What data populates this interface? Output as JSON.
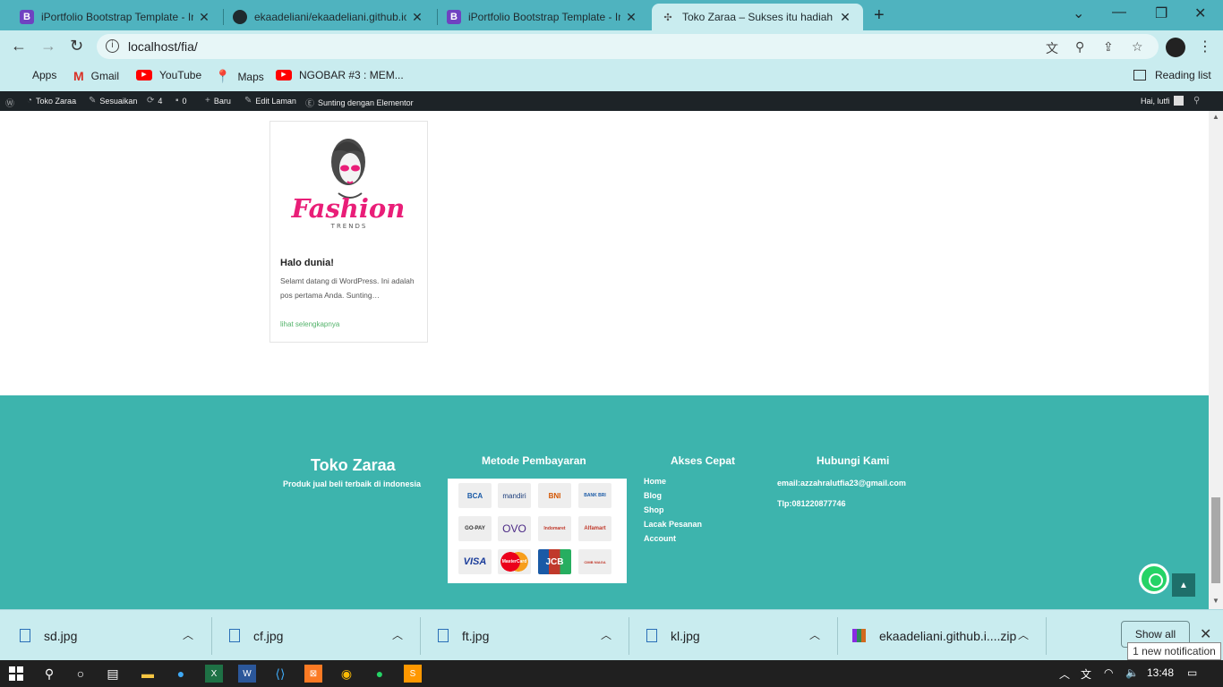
{
  "browser": {
    "tabs": [
      {
        "title": "iPortfolio Bootstrap Template - In",
        "icon": "bootstrap-icon",
        "active": false
      },
      {
        "title": "ekaadeliani/ekaadeliani.github.io",
        "icon": "github-icon",
        "active": false
      },
      {
        "title": "iPortfolio Bootstrap Template - In",
        "icon": "bootstrap-icon",
        "active": false
      },
      {
        "title": "Toko Zaraa – Sukses itu hadiah b",
        "icon": "site-icon",
        "active": true
      }
    ],
    "url": "localhost/fia/",
    "bookmarks": [
      {
        "label": "Apps"
      },
      {
        "label": "Gmail"
      },
      {
        "label": "YouTube"
      },
      {
        "label": "Maps"
      },
      {
        "label": "NGOBAR #3 : MEM..."
      }
    ],
    "reading_list": "Reading list"
  },
  "wpbar": {
    "site": "Toko Zaraa",
    "customize": "Sesuaikan",
    "updates": "4",
    "comments": "0",
    "new": "Baru",
    "edit": "Edit Laman",
    "elementor": "Sunting dengan Elementor",
    "greeting": "Hai, lutfi"
  },
  "post": {
    "title": "Halo dunia!",
    "excerpt": "Selamt datang di WordPress. Ini adalah pos pertama Anda. Sunting…",
    "more": "lihat selengkapnya",
    "logo_word": "Fashion",
    "logo_sub": "TRENDS"
  },
  "footer": {
    "brand": "Toko Zaraa",
    "tagline": "Produk jual beli terbaik di indonesia",
    "payment_heading": "Metode Pembayaran",
    "payments": [
      "BCA",
      "mandiri",
      "BNI",
      "BANK BRI",
      "GO-PAY",
      "OVO",
      "Indomaret",
      "Alfamart",
      "VISA",
      "MasterCard",
      "JCB",
      "CIMB NIAGA"
    ],
    "links_heading": "Akses Cepat",
    "links": [
      "Home",
      "Blog",
      "Shop",
      "Lacak Pesanan",
      "Account"
    ],
    "contact_heading": "Hubungi Kami",
    "email": "email:azzahralutfia23@gmail.com",
    "phone": "Tlp:081220877746"
  },
  "downloads": {
    "items": [
      "sd.jpg",
      "cf.jpg",
      "ft.jpg",
      "kl.jpg",
      "ekaadeliani.github.i....zip"
    ],
    "show_all": "Show all",
    "notification": "1 new notification"
  },
  "taskbar": {
    "time": "13:48"
  }
}
